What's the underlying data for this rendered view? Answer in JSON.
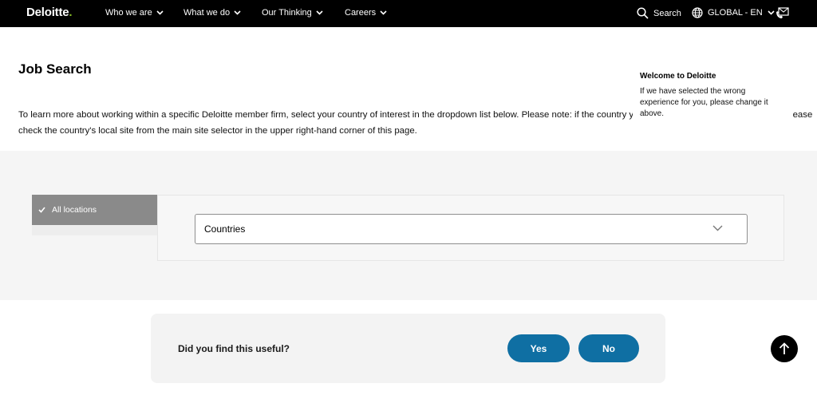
{
  "header": {
    "logo": "Deloitte",
    "logo_dot": ".",
    "nav": [
      "Who we are",
      "What we do",
      "Our Thinking",
      "Careers"
    ],
    "search_label": "Search",
    "region_label": "GLOBAL - EN"
  },
  "page": {
    "title": "Job Search",
    "intro": "To learn more about working within a specific Deloitte member firm, select your country of interest in the dropdown list below. Please note: if the country you seek is not listed in the dropdown, please check the country's local site from the main site selector in the upper right-hand corner of this page."
  },
  "welcome_popup": {
    "title": "Welcome to Deloitte",
    "text": "If we have selected the wrong experience for you, please change it above."
  },
  "filters": {
    "location_item": "All locations",
    "country_select_value": "Countries"
  },
  "feedback": {
    "question": "Did you find this useful?",
    "yes_label": "Yes",
    "no_label": "No"
  },
  "colors": {
    "nav_bg": "#000000",
    "brand_green": "#86bc25",
    "button_blue": "#0f6fa3"
  },
  "icons": {
    "nav_dropdown": "chevron-down-icon",
    "search": "search-icon",
    "region": "globe-icon",
    "contact": "phone-mail-icon",
    "location_check": "check-icon",
    "select_chevron": "chevron-down-icon",
    "back_to_top": "arrow-up-icon"
  }
}
